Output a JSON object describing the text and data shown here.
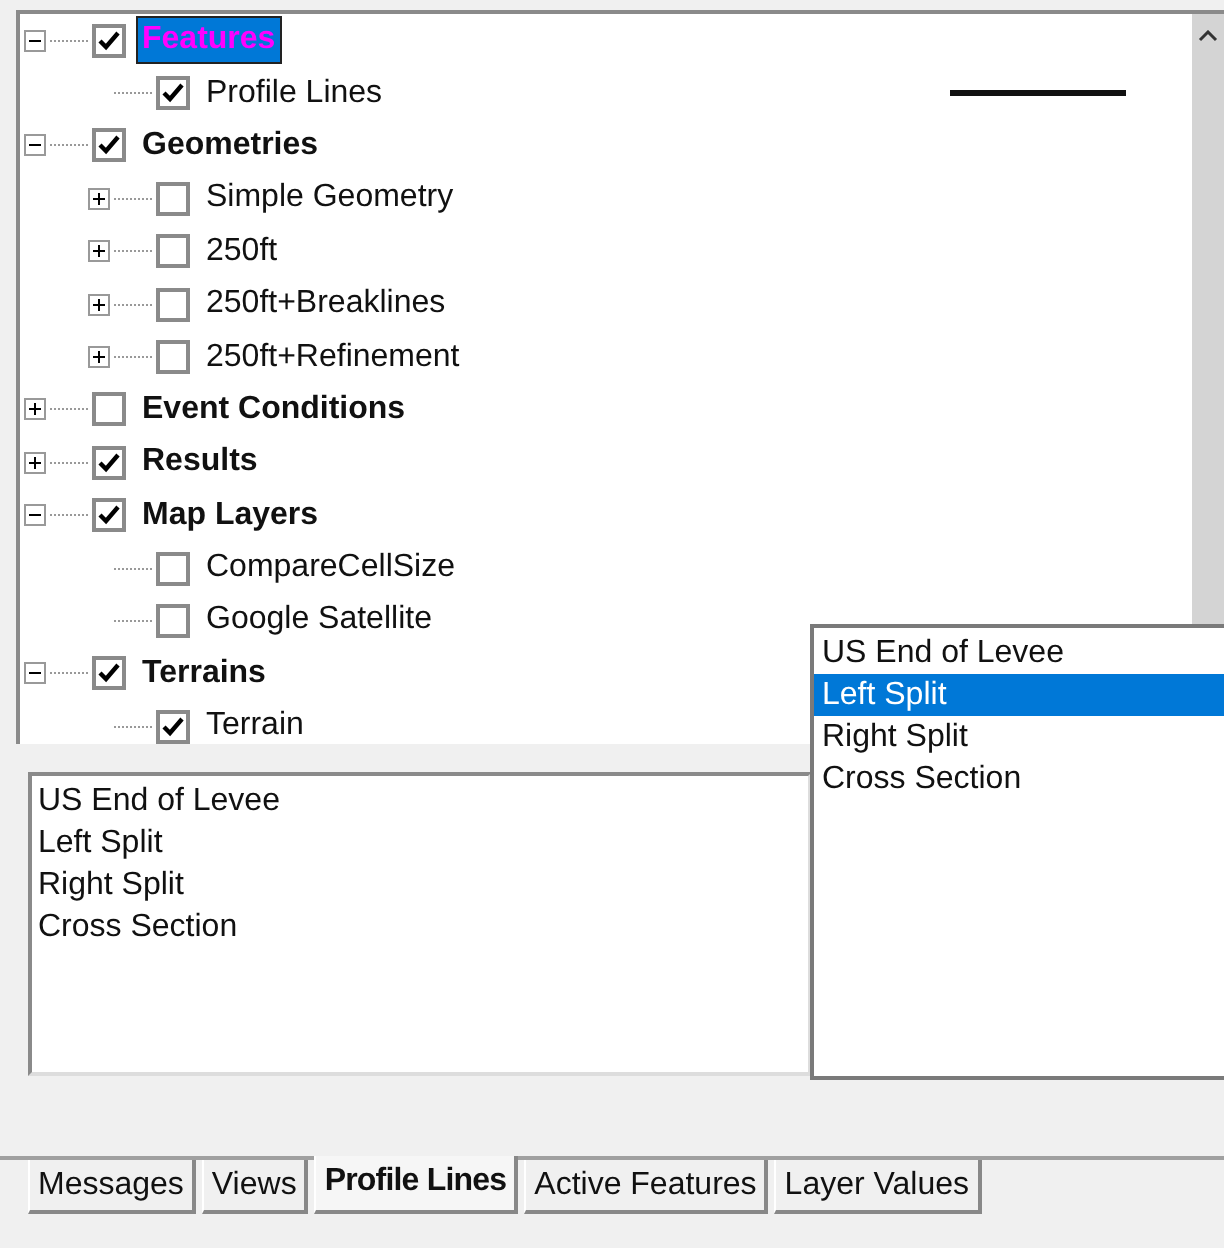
{
  "tree": {
    "items": [
      {
        "label": "Features",
        "checked": true,
        "expanded": true,
        "selected": true,
        "children": [
          {
            "label": "Profile Lines",
            "checked": true,
            "selected": false
          }
        ]
      },
      {
        "label": "Geometries",
        "checked": true,
        "expanded": true,
        "selected": false,
        "children": [
          {
            "label": "Simple Geometry",
            "checked": false,
            "expanded": false,
            "selected": false
          },
          {
            "label": "250ft",
            "checked": false,
            "expanded": false,
            "selected": false
          },
          {
            "label": "250ft+Breaklines",
            "checked": false,
            "expanded": false,
            "selected": false
          },
          {
            "label": "250ft+Refinement",
            "checked": false,
            "expanded": false,
            "selected": false
          }
        ]
      },
      {
        "label": "Event Conditions",
        "checked": false,
        "expanded": false,
        "selected": false
      },
      {
        "label": "Results",
        "checked": true,
        "expanded": false,
        "selected": false
      },
      {
        "label": "Map Layers",
        "checked": true,
        "expanded": true,
        "selected": false,
        "children": [
          {
            "label": "CompareCellSize",
            "checked": false,
            "selected": false
          },
          {
            "label": "Google Satellite",
            "checked": false,
            "selected": false
          }
        ]
      },
      {
        "label": "Terrains",
        "checked": true,
        "expanded": true,
        "selected": false,
        "children": [
          {
            "label": "Terrain",
            "checked": true,
            "selected": false
          }
        ]
      }
    ]
  },
  "profile_list": {
    "items": [
      "US End of Levee",
      "Left Split",
      "Right Split",
      "Cross Section"
    ]
  },
  "dropdown_list": {
    "items": [
      {
        "label": "US End of Levee",
        "selected": false
      },
      {
        "label": "Left Split",
        "selected": true
      },
      {
        "label": "Right Split",
        "selected": false
      },
      {
        "label": "Cross Section",
        "selected": false
      }
    ]
  },
  "tabs": [
    {
      "label": "Messages",
      "selected": false
    },
    {
      "label": "Views",
      "selected": false
    },
    {
      "label": "Profile Lines",
      "selected": true
    },
    {
      "label": "Active Features",
      "selected": false
    },
    {
      "label": "Layer Values",
      "selected": false
    }
  ]
}
